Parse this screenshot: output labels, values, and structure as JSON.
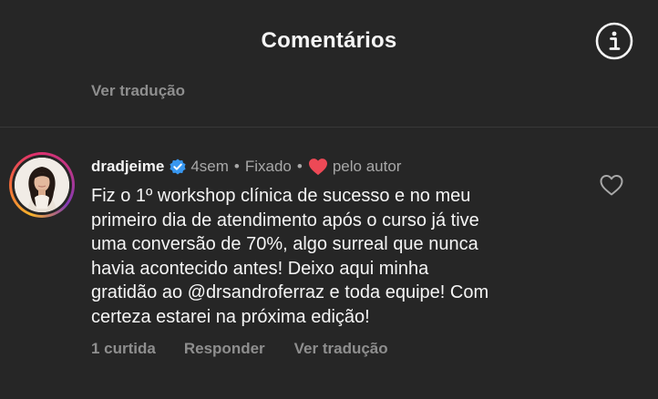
{
  "header": {
    "title": "Comentários",
    "info_icon": "info-circle-icon"
  },
  "previous_comment": {
    "translate_label": "Ver tradução"
  },
  "comment": {
    "username": "dradjeime",
    "verified_icon": "verified-badge-icon",
    "time": "4sem",
    "pinned_label": "Fixado",
    "liked_by_author_icon": "heart-filled-icon",
    "liked_by_author_label": "pelo autor",
    "text_lines": [
      "Fiz o 1º workshop clínica de sucesso e no meu",
      "primeiro dia de atendimento após o curso já tive",
      "uma conversão de 70%, algo surreal que nunca",
      "havia acontecido antes! Deixo aqui minha",
      "gratidão ao @drsandroferraz e toda equipe! Com",
      "certeza estarei na próxima edição!"
    ],
    "like_icon": "heart-outline-icon",
    "likes_label": "1 curtida",
    "reply_label": "Responder",
    "translate_label": "Ver tradução"
  },
  "colors": {
    "background": "#262626",
    "text_primary": "#f5f5f5",
    "text_secondary": "#8e8e8e",
    "verified_blue": "#3897f0",
    "heart_red": "#ed4956"
  }
}
